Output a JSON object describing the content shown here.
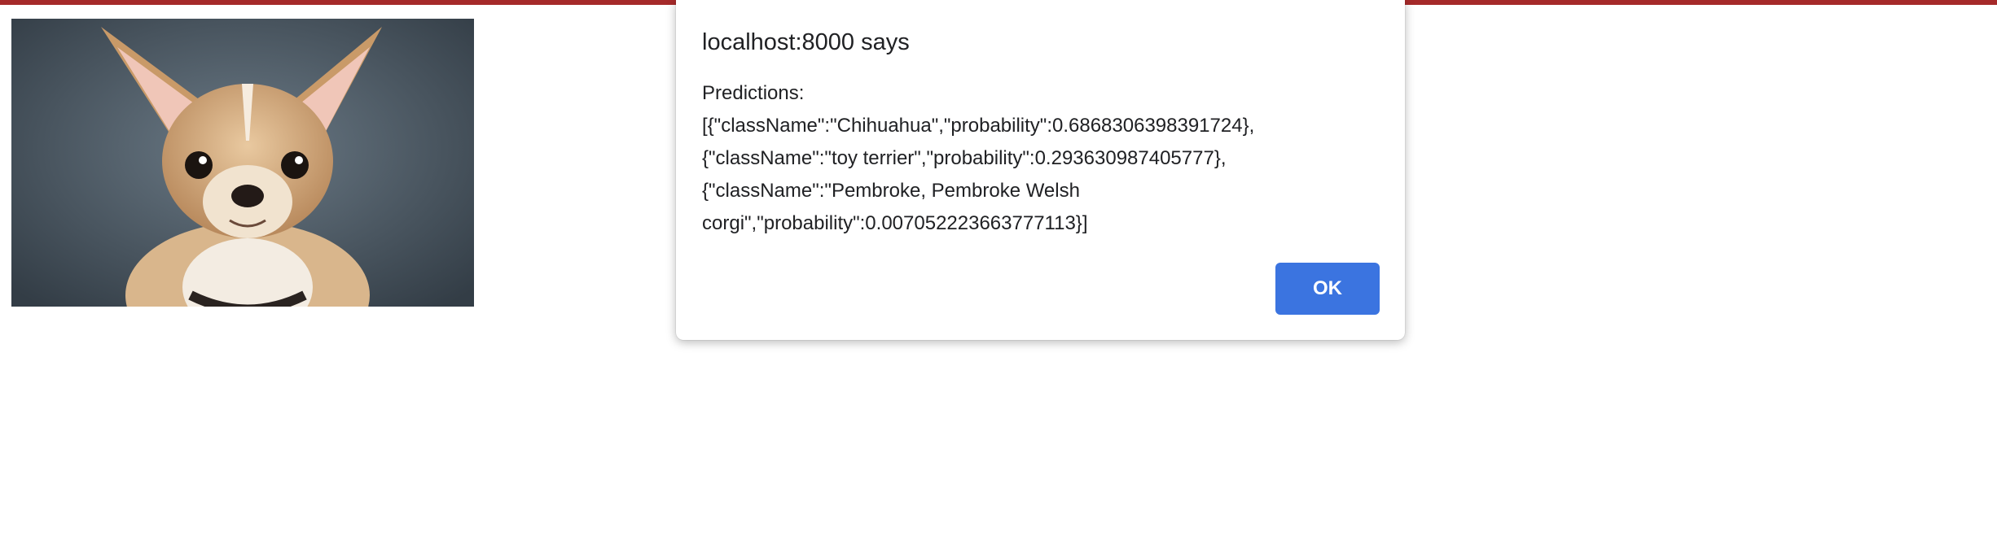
{
  "photo": {
    "subject": "chihuahua-photo"
  },
  "dialog": {
    "title": "localhost:8000 says",
    "message_lines": [
      "Predictions:",
      "[{\"className\":\"Chihuahua\",\"probability\":0.6868306398391724},",
      "{\"className\":\"toy terrier\",\"probability\":0.293630987405777},",
      "{\"className\":\"Pembroke, Pembroke Welsh",
      "corgi\",\"probability\":0.007052223663777113}]"
    ],
    "ok_label": "OK"
  },
  "colors": {
    "top_strip": "#a52a2a",
    "ok_button": "#3b74e0",
    "text": "#202124"
  }
}
